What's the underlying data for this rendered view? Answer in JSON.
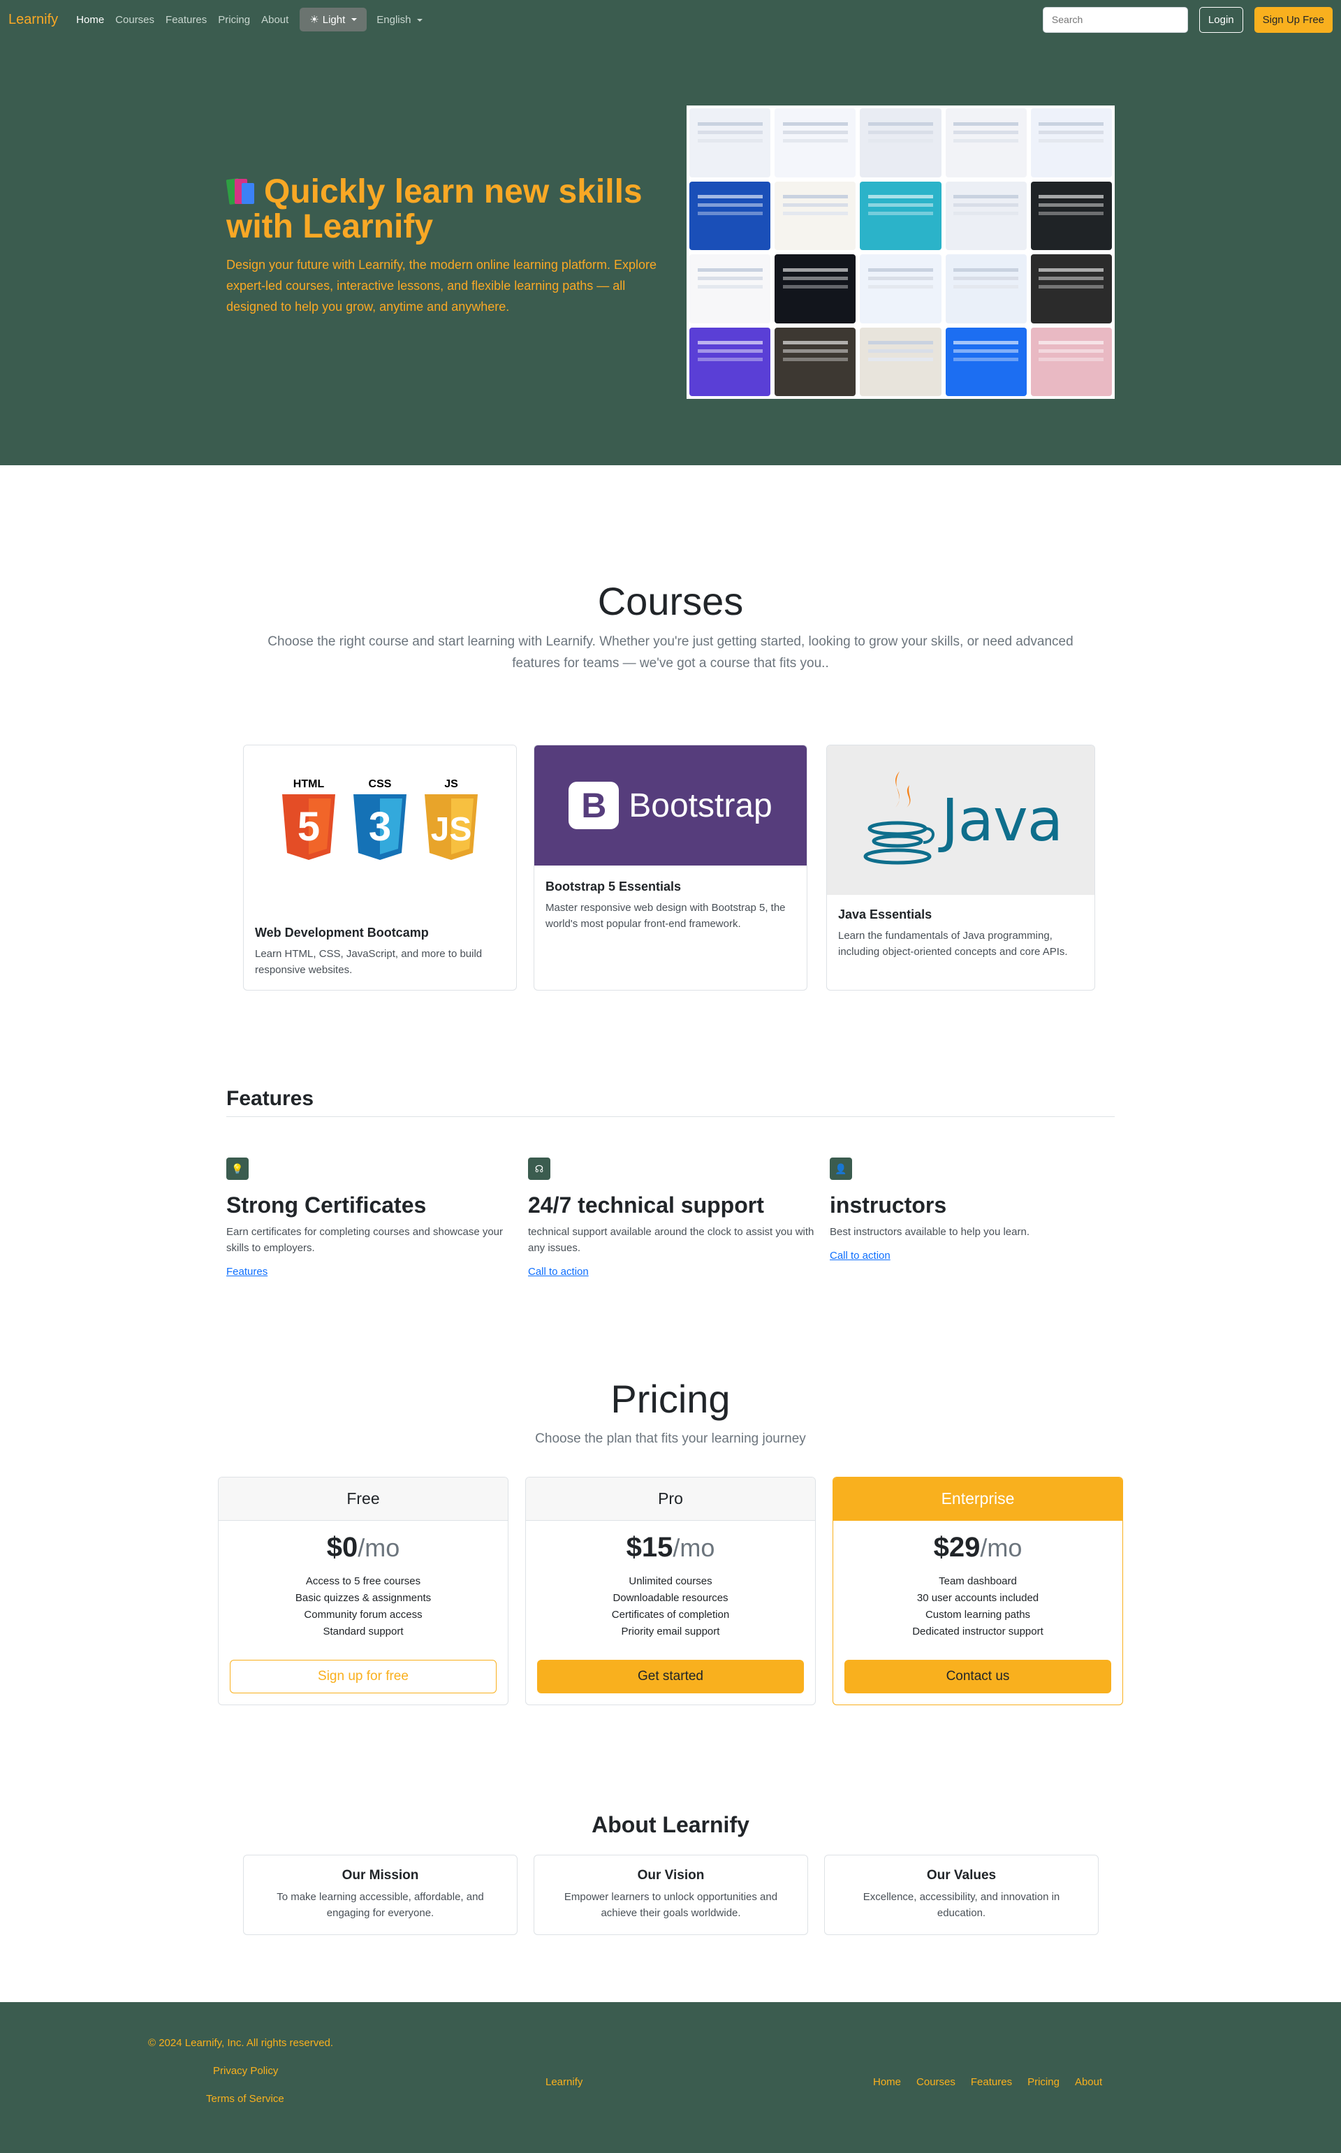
{
  "nav": {
    "brand": "Learnify",
    "links": [
      "Home",
      "Courses",
      "Features",
      "Pricing",
      "About"
    ],
    "theme_label": "Light",
    "language_label": "English",
    "search_placeholder": "Search",
    "login_label": "Login",
    "signup_label": "Sign Up Free"
  },
  "hero": {
    "title": "Quickly learn new skills with Learnify",
    "description": "Design your future with Learnify, the modern online learning platform. Explore expert-led courses, interactive lessons, and flexible learning paths — all designed to help you grow, anytime and anywhere."
  },
  "courses": {
    "title": "Courses",
    "subtitle": "Choose the right course and start learning with Learnify. Whether you're just getting started, looking to grow your skills, or need advanced features for teams — we've got a course that fits you..",
    "items": [
      {
        "title": "Web Development Bootcamp",
        "description": "Learn HTML, CSS, JavaScript, and more to build responsive websites.",
        "logo_labels": [
          "HTML",
          "CSS",
          "JS"
        ]
      },
      {
        "title": "Bootstrap 5 Essentials",
        "description": "Master responsive web design with Bootstrap 5, the world's most popular front-end framework.",
        "logo_text": "Bootstrap"
      },
      {
        "title": "Java Essentials",
        "description": "Learn the fundamentals of Java programming, including object-oriented concepts and core APIs.",
        "logo_text": "Java"
      }
    ]
  },
  "features": {
    "title": "Features",
    "items": [
      {
        "icon": "lightbulb-icon",
        "title": "Strong Certificates",
        "description": "Earn certificates for completing courses and showcase your skills to employers.",
        "link": "Features"
      },
      {
        "icon": "headset-icon",
        "title": "24/7 technical support",
        "description": "technical support available around the clock to assist you with any issues.",
        "link": "Call to action"
      },
      {
        "icon": "person-icon",
        "title": "instructors",
        "description": "Best instructors available to help you learn.",
        "link": "Call to action"
      }
    ]
  },
  "pricing": {
    "title": "Pricing",
    "subtitle": "Choose the plan that fits your learning journey",
    "plans": [
      {
        "name": "Free",
        "price": "$0",
        "period": "/mo",
        "features": [
          "Access to 5 free courses",
          "Basic quizzes & assignments",
          "Community forum access",
          "Standard support"
        ],
        "button": "Sign up for free"
      },
      {
        "name": "Pro",
        "price": "$15",
        "period": "/mo",
        "features": [
          "Unlimited courses",
          "Downloadable resources",
          "Certificates of completion",
          "Priority email support"
        ],
        "button": "Get started"
      },
      {
        "name": "Enterprise",
        "price": "$29",
        "period": "/mo",
        "features": [
          "Team dashboard",
          "30 user accounts included",
          "Custom learning paths",
          "Dedicated instructor support"
        ],
        "button": "Contact us"
      }
    ]
  },
  "about": {
    "title": "About Learnify",
    "cards": [
      {
        "title": "Our Mission",
        "text": "To make learning accessible, affordable, and engaging for everyone."
      },
      {
        "title": "Our Vision",
        "text": "Empower learners to unlock opportunities and achieve their goals worldwide."
      },
      {
        "title": "Our Values",
        "text": "Excellence, accessibility, and innovation in education."
      }
    ]
  },
  "footer": {
    "copyright": "© 2024 Learnify, Inc. All rights reserved.",
    "privacy": "Privacy Policy",
    "terms": "Terms of Service",
    "brand": "Learnify",
    "links": [
      "Home",
      "Courses",
      "Features",
      "Pricing",
      "About"
    ]
  },
  "colors": {
    "primary_green": "#3b5c4f",
    "accent_orange": "#f9b01e",
    "hero_text": "#f9a825",
    "bootstrap_purple": "#563d7c",
    "java_blue": "#0e6e8c"
  }
}
